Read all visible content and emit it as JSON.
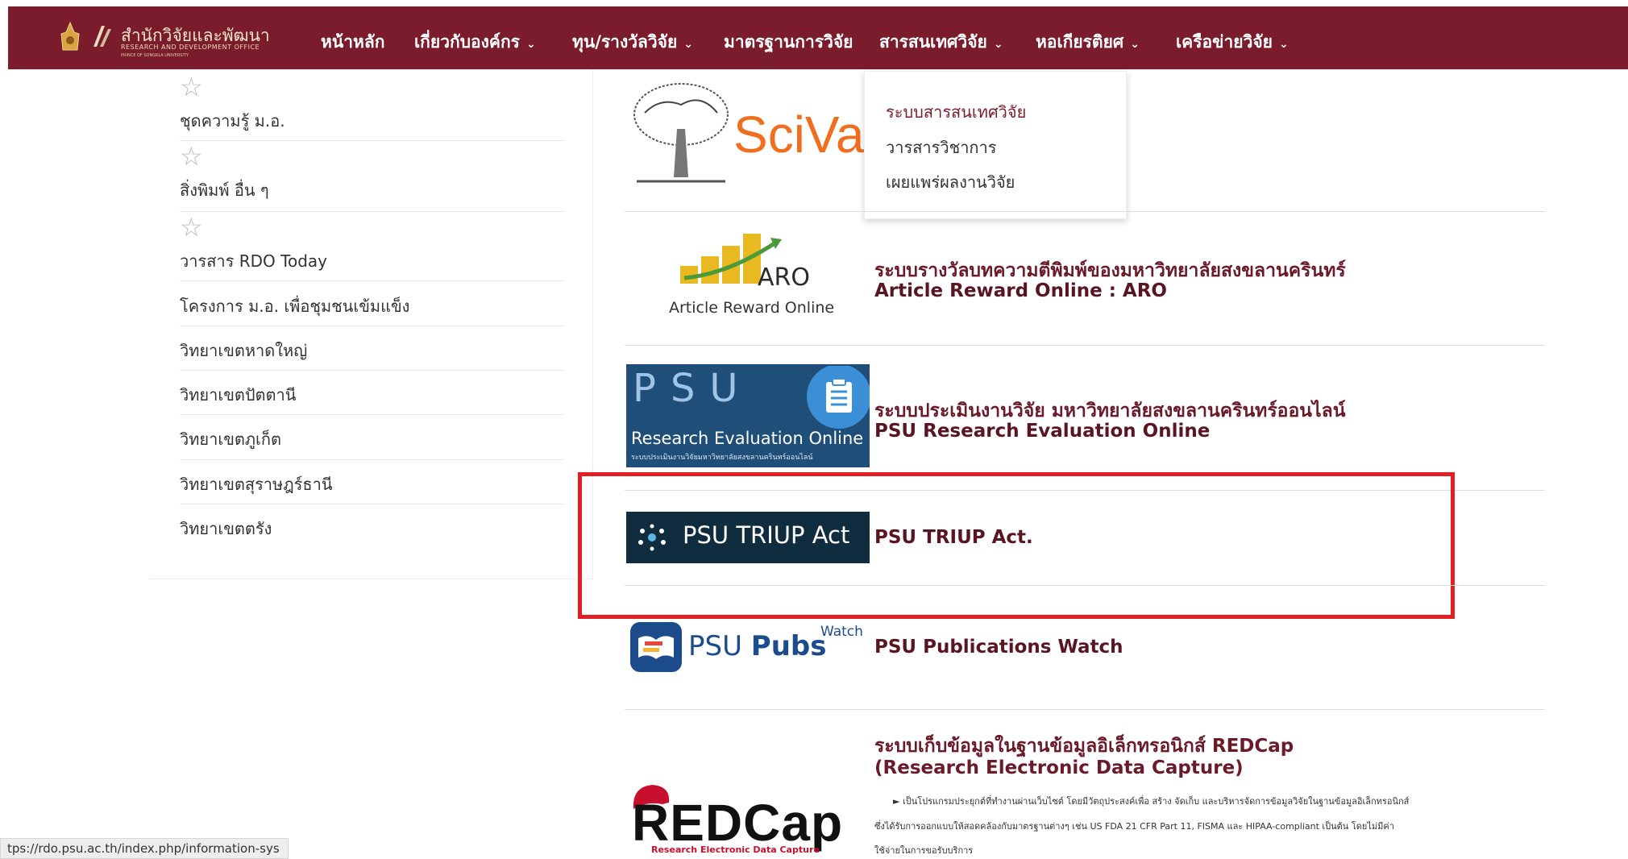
{
  "nav": {
    "logo": {
      "title": "สำนักวิจัยและพัฒนา",
      "subtitle": "RESEARCH AND DEVELOPMENT OFFICE",
      "subtitle2": "PRINCE OF SONGKLA UNIVERSITY"
    },
    "items": [
      {
        "label": "หน้าหลัก",
        "chevron": false
      },
      {
        "label": "เกี่ยวกับองค์กร",
        "chevron": true
      },
      {
        "label": "ทุน/รางวัลวิจัย",
        "chevron": true
      },
      {
        "label": "มาตรฐานการวิจัย",
        "chevron": false
      },
      {
        "label": "สารสนเทศวิจัย",
        "chevron": true
      },
      {
        "label": "หอเกียรติยศ",
        "chevron": true
      },
      {
        "label": "เครือข่ายวิจัย",
        "chevron": true
      }
    ],
    "chevron_glyph": "❯"
  },
  "dropdown": {
    "items": [
      "ระบบสารสนเทศวิจัย",
      "วารสารวิชาการ",
      "เผยแพร่ผลงานวิจัย"
    ]
  },
  "sidebar": {
    "items": [
      "ชุดความรู้ ม.อ.",
      "สิ่งพิมพ์ อื่น ๆ",
      "วารสาร RDO Today",
      "โครงการ ม.อ. เพื่อชุมชนเข้มแข็ง",
      "วิทยาเขตหาดใหญ่",
      "วิทยาเขตปัตตานี",
      "วิทยาเขตภูเก็ต",
      "วิทยาเขตสุราษฎร์ธานี",
      "วิทยาเขตตรัง"
    ]
  },
  "systems": {
    "scival": {
      "logo_text": "SciVal"
    },
    "aro": {
      "logo_text": "ARO",
      "logo_caption": "Article Reward Online",
      "title_th": "ระบบรางวัลบทความตีพิมพ์ของมหาวิทยาลัยสงขลานครินทร์",
      "title_en": "Article Reward Online : ARO"
    },
    "psu_eval": {
      "logo_big": "PSU",
      "logo_caption": "Research Evaluation Online",
      "logo_small": "ระบบประเมินงานวิจัยมหาวิทยาลัยสงขลานครินทร์ออนไลน์",
      "title_th": "ระบบประเมินงานวิจัย มหาวิทยาลัยสงขลานครินทร์ออนไลน์",
      "title_en": "PSU Research Evaluation Online"
    },
    "triup": {
      "logo_text": "PSU TRIUP Act",
      "title": "PSU TRIUP Act."
    },
    "pubs": {
      "logo_psu": "PSU",
      "logo_pubs": "Pubs",
      "logo_watch": "Watch",
      "title": "PSU Publications Watch"
    },
    "redcap": {
      "logo_text": "REDCap",
      "logo_caption": "Research Electronic Data Capture",
      "title_th": "ระบบเก็บข้อมูลในฐานข้อมูลอิเล็กทรอนิกส์ REDCap",
      "title_en": "(Research Electronic Data Capture)",
      "desc1": "► เป็นโปรแกรมประยุกต์ที่ทำงานผ่านเว็บไซต์ โดยมีวัตถุประสงค์เพื่อ สร้าง จัดเก็บ และบริหารจัดการข้อมูลวิจัยในฐานข้อมูลอิเล็กทรอนิกส์",
      "desc2": "ซึ่งได้รับการออกแบบให้สอดคล้องกับมาตรฐานต่างๆ เช่น US FDA 21 CFR Part 11, FISMA และ HIPAA-compliant เป็นต้น โดยไม่มีค่า",
      "desc3": "ใช้จ่ายในการขอรับบริการ"
    }
  },
  "status_bar": {
    "url": "tps://rdo.psu.ac.th/index.php/information-sys"
  },
  "colors": {
    "brand": "#7b1c2c",
    "highlight": "#e31e24",
    "aro_gold": "#e8b920",
    "redcap_red": "#c8102e"
  }
}
